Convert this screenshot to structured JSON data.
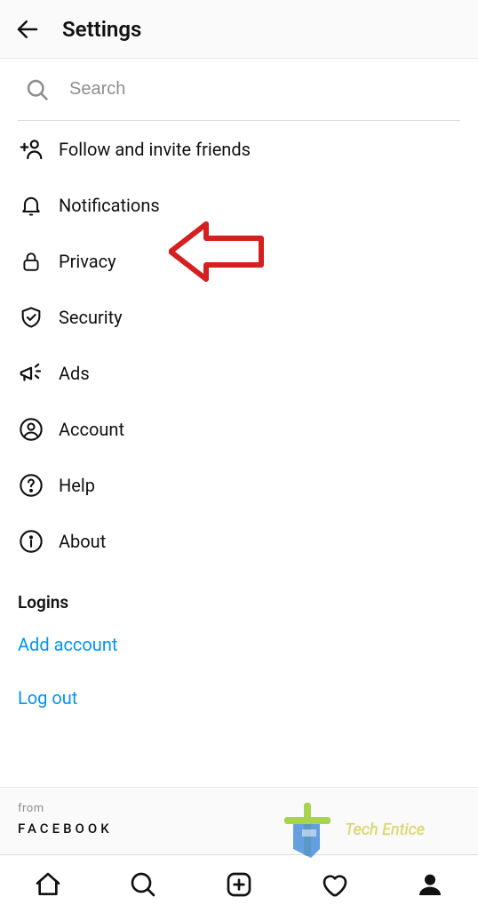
{
  "header": {
    "title": "Settings"
  },
  "search": {
    "placeholder": "Search"
  },
  "menu": [
    {
      "id": "follow-invite",
      "label": "Follow and invite friends"
    },
    {
      "id": "notifications",
      "label": "Notifications"
    },
    {
      "id": "privacy",
      "label": "Privacy"
    },
    {
      "id": "security",
      "label": "Security"
    },
    {
      "id": "ads",
      "label": "Ads"
    },
    {
      "id": "account",
      "label": "Account"
    },
    {
      "id": "help",
      "label": "Help"
    },
    {
      "id": "about",
      "label": "About"
    }
  ],
  "logins": {
    "heading": "Logins",
    "add": "Add account",
    "logout": "Log out"
  },
  "footer": {
    "from": "from",
    "company": "FACEBOOK"
  },
  "watermark": "Tech Entice"
}
